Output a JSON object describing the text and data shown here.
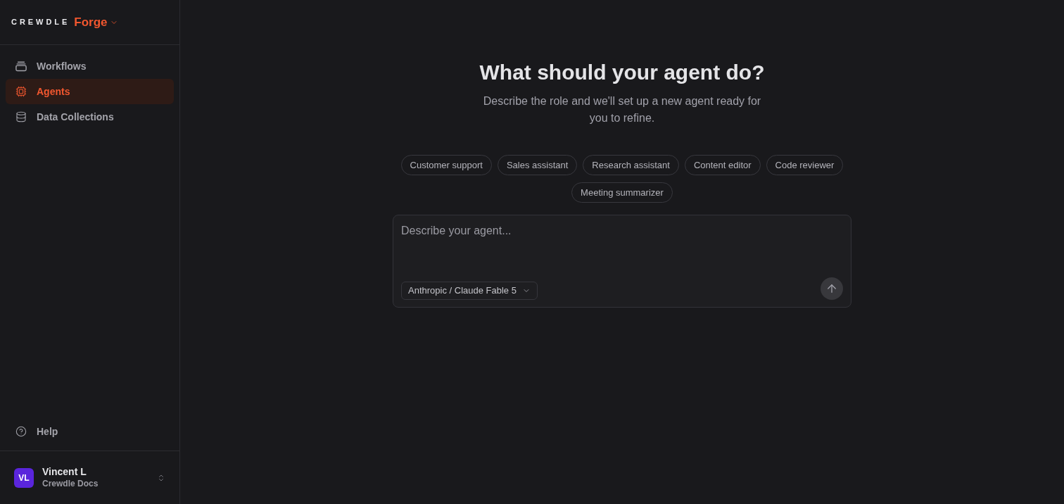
{
  "brand": {
    "wordmark": "CREWDLE",
    "product": "Forge"
  },
  "nav": [
    {
      "label": "Workflows",
      "selected": false
    },
    {
      "label": "Agents",
      "selected": true
    },
    {
      "label": "Data Collections",
      "selected": false
    }
  ],
  "help": {
    "label": "Help"
  },
  "user": {
    "initials": "VL",
    "name": "Vincent L",
    "workspace": "Crewdle Docs"
  },
  "hero": {
    "title": "What should your agent do?",
    "subtitle": "Describe the role and we'll set up a new agent ready for you to refine."
  },
  "suggestions": [
    "Customer support",
    "Sales assistant",
    "Research assistant",
    "Content editor",
    "Code reviewer",
    "Meeting summarizer"
  ],
  "composer": {
    "placeholder": "Describe your agent...",
    "model": "Anthropic / Claude Fable 5"
  }
}
